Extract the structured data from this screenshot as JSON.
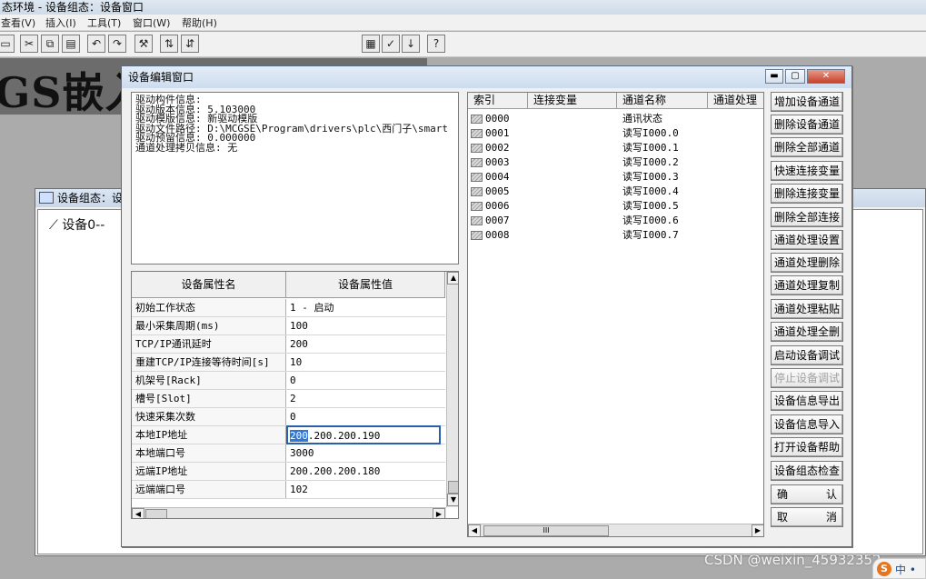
{
  "app": {
    "title": "态环境 - 设备组态：设备窗口",
    "menu": [
      "查看(V)",
      "插入(I)",
      "工具(T)",
      "窗口(W)",
      "帮助(H)"
    ],
    "banner_text": "GS嵌入式组态软件"
  },
  "toolbar": {
    "icons": [
      "print-preview-icon",
      "cut-icon",
      "copy-icon",
      "paste-icon",
      "undo-icon",
      "redo-icon",
      "tools-icon",
      "device-config-icon",
      "device-window-icon",
      "properties-icon",
      "check-icon",
      "download-icon",
      "help-icon"
    ]
  },
  "device_window": {
    "title": "设备组态：设",
    "tree_node": "设备0--"
  },
  "dialog": {
    "title": "设备编辑窗口",
    "driver_info": "驱动构件信息:\n驱动版本信息: 5.103000\n驱动模版信息: 新驱动模版\n驱动文件路径: D:\\MCGSE\\Program\\drivers\\plc\\西门子\\smart\n驱动预留信息: 0.000000\n通道处理拷贝信息: 无",
    "props": {
      "col_name": "设备属性名",
      "col_value": "设备属性值",
      "rows": [
        {
          "name": "初始工作状态",
          "value": "1 - 启动"
        },
        {
          "name": "最小采集周期(ms)",
          "value": "100"
        },
        {
          "name": "TCP/IP通讯延时",
          "value": "200"
        },
        {
          "name": "重建TCP/IP连接等待时间[s]",
          "value": "10"
        },
        {
          "name": "机架号[Rack]",
          "value": "0"
        },
        {
          "name": "槽号[Slot]",
          "value": "2"
        },
        {
          "name": "快速采集次数",
          "value": "0"
        },
        {
          "name": "本地IP地址",
          "value": "200.200.200.190",
          "value_selected": "200",
          "value_rest": ".200.200.190"
        },
        {
          "name": "本地端口号",
          "value": "3000"
        },
        {
          "name": "远端IP地址",
          "value": "200.200.200.180"
        },
        {
          "name": "远端端口号",
          "value": "102"
        }
      ]
    },
    "channels": {
      "columns": [
        "索引",
        "连接变量",
        "通道名称",
        "通道处理"
      ],
      "rows": [
        {
          "index": "0000",
          "name": "通讯状态"
        },
        {
          "index": "0001",
          "name": "读写I000.0"
        },
        {
          "index": "0002",
          "name": "读写I000.1"
        },
        {
          "index": "0003",
          "name": "读写I000.2"
        },
        {
          "index": "0004",
          "name": "读写I000.3"
        },
        {
          "index": "0005",
          "name": "读写I000.4"
        },
        {
          "index": "0006",
          "name": "读写I000.5"
        },
        {
          "index": "0007",
          "name": "读写I000.6"
        },
        {
          "index": "0008",
          "name": "读写I000.7"
        }
      ],
      "scroll_thumb_label": "III"
    },
    "buttons": [
      {
        "label": "增加设备通道",
        "enabled": true
      },
      {
        "label": "删除设备通道",
        "enabled": true
      },
      {
        "label": "删除全部通道",
        "enabled": true
      },
      {
        "label": "快速连接变量",
        "enabled": true
      },
      {
        "label": "删除连接变量",
        "enabled": true
      },
      {
        "label": "删除全部连接",
        "enabled": true
      },
      {
        "label": "通道处理设置",
        "enabled": true
      },
      {
        "label": "通道处理删除",
        "enabled": true
      },
      {
        "label": "通道处理复制",
        "enabled": true
      },
      {
        "label": "通道处理粘贴",
        "enabled": true
      },
      {
        "label": "通道处理全删",
        "enabled": true
      },
      {
        "label": "启动设备调试",
        "enabled": true
      },
      {
        "label": "停止设备调试",
        "enabled": false
      },
      {
        "label": "设备信息导出",
        "enabled": true
      },
      {
        "label": "设备信息导入",
        "enabled": true
      },
      {
        "label": "打开设备帮助",
        "enabled": true
      },
      {
        "label": "设备组态检查",
        "enabled": true
      }
    ],
    "ok": {
      "left": "确",
      "right": "认"
    },
    "cancel": {
      "left": "取",
      "right": "消"
    }
  },
  "overlay": {
    "watermark": "CSDN @weixin_45932352",
    "ime_logo": "S",
    "ime_text": "中 •"
  },
  "colors": {
    "titlebar": "#cddcee",
    "selection": "#3078d8",
    "close_button": "#c5422b"
  }
}
